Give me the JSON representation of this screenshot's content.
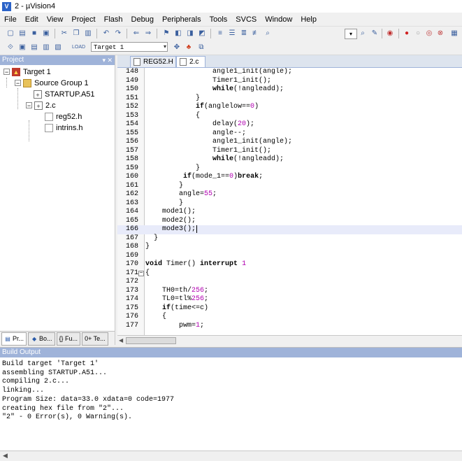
{
  "window": {
    "title": "2 - µVision4"
  },
  "menu": [
    "File",
    "Edit",
    "View",
    "Project",
    "Flash",
    "Debug",
    "Peripherals",
    "Tools",
    "SVCS",
    "Window",
    "Help"
  ],
  "toolbar": {
    "target_select": "Target 1"
  },
  "project_panel": {
    "title": "Project",
    "controls": "▾ ✕",
    "tree": {
      "target": "Target 1",
      "group": "Source Group 1",
      "files": [
        "STARTUP.A51",
        "2.c"
      ],
      "includes": [
        "reg52.h",
        "intrins.h"
      ]
    },
    "tabs": [
      "Pr...",
      "Bo...",
      "{} Fu...",
      "0+ Te..."
    ]
  },
  "editor": {
    "tabs": [
      "REG52.H",
      "2.c"
    ],
    "active_tab": "2.c",
    "current_line": 166,
    "lines": [
      {
        "n": 148,
        "code": "                angle1_init(angle);"
      },
      {
        "n": 149,
        "code": "                Timer1_init();"
      },
      {
        "n": 150,
        "code": "                while(!angleadd);"
      },
      {
        "n": 151,
        "code": "            }"
      },
      {
        "n": 152,
        "code": "            if(anglelow==0)"
      },
      {
        "n": 153,
        "code": "            {"
      },
      {
        "n": 154,
        "code": "                delay(20);"
      },
      {
        "n": 155,
        "code": "                angle--;"
      },
      {
        "n": 156,
        "code": "                angle1_init(angle);"
      },
      {
        "n": 157,
        "code": "                Timer1_init();"
      },
      {
        "n": 158,
        "code": "                while(!angleadd);"
      },
      {
        "n": 159,
        "code": "            }"
      },
      {
        "n": 160,
        "code": "         if(mode_1==0)break;"
      },
      {
        "n": 161,
        "code": "        }"
      },
      {
        "n": 162,
        "code": "        angle=55;"
      },
      {
        "n": 163,
        "code": "        }"
      },
      {
        "n": 164,
        "code": "    mode1();"
      },
      {
        "n": 165,
        "code": "    mode2();"
      },
      {
        "n": 166,
        "code": "    mode3();"
      },
      {
        "n": 167,
        "code": "  }"
      },
      {
        "n": 168,
        "code": "}"
      },
      {
        "n": 169,
        "code": ""
      },
      {
        "n": 170,
        "code": "void Timer() interrupt 1"
      },
      {
        "n": 171,
        "code": "{"
      },
      {
        "n": 172,
        "code": ""
      },
      {
        "n": 173,
        "code": "    TH0=th/256;"
      },
      {
        "n": 174,
        "code": "    TL0=tl%256;"
      },
      {
        "n": 175,
        "code": "    if(time<=c)"
      },
      {
        "n": 176,
        "code": "    {"
      },
      {
        "n": 177,
        "code": "        pwm=1;"
      }
    ]
  },
  "build_output": {
    "title": "Build Output",
    "lines": [
      "Build target 'Target 1'",
      "assembling STARTUP.A51...",
      "compiling 2.c...",
      "linking...",
      "Program Size: data=33.0 xdata=0 code=1977",
      "creating hex file from \"2\"...",
      "\"2\" - 0 Error(s), 0 Warning(s)."
    ]
  }
}
